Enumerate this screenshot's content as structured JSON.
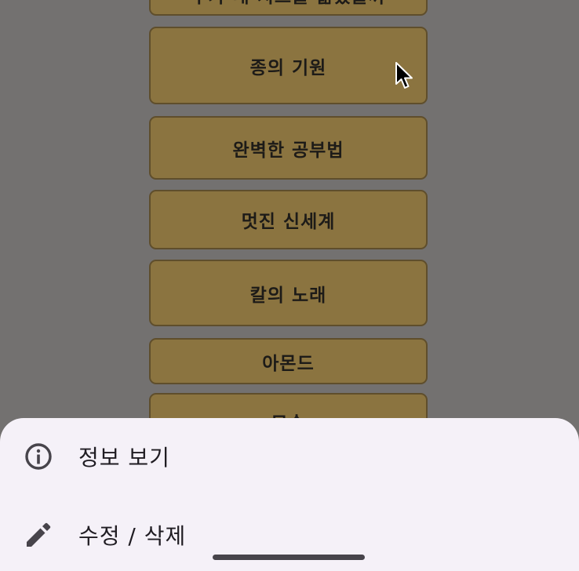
{
  "book_list": {
    "items": [
      {
        "title": "누가 내 치즈를 옮겼을까"
      },
      {
        "title": "종의 기원"
      },
      {
        "title": "완벽한 공부법"
      },
      {
        "title": "멋진 신세계"
      },
      {
        "title": "칼의 노래"
      },
      {
        "title": "아몬드"
      },
      {
        "title": "모순"
      }
    ]
  },
  "bottom_sheet": {
    "info": {
      "label": "정보 보기",
      "icon": "info-icon"
    },
    "edit": {
      "label": "수정 / 삭제",
      "icon": "pencil-icon"
    }
  },
  "colors": {
    "scrim_background": "#737170",
    "card_fill": "#8b7440",
    "card_border": "#5f4e2c",
    "sheet_background": "#f5f1f8",
    "text_dark": "#1f1c22"
  }
}
